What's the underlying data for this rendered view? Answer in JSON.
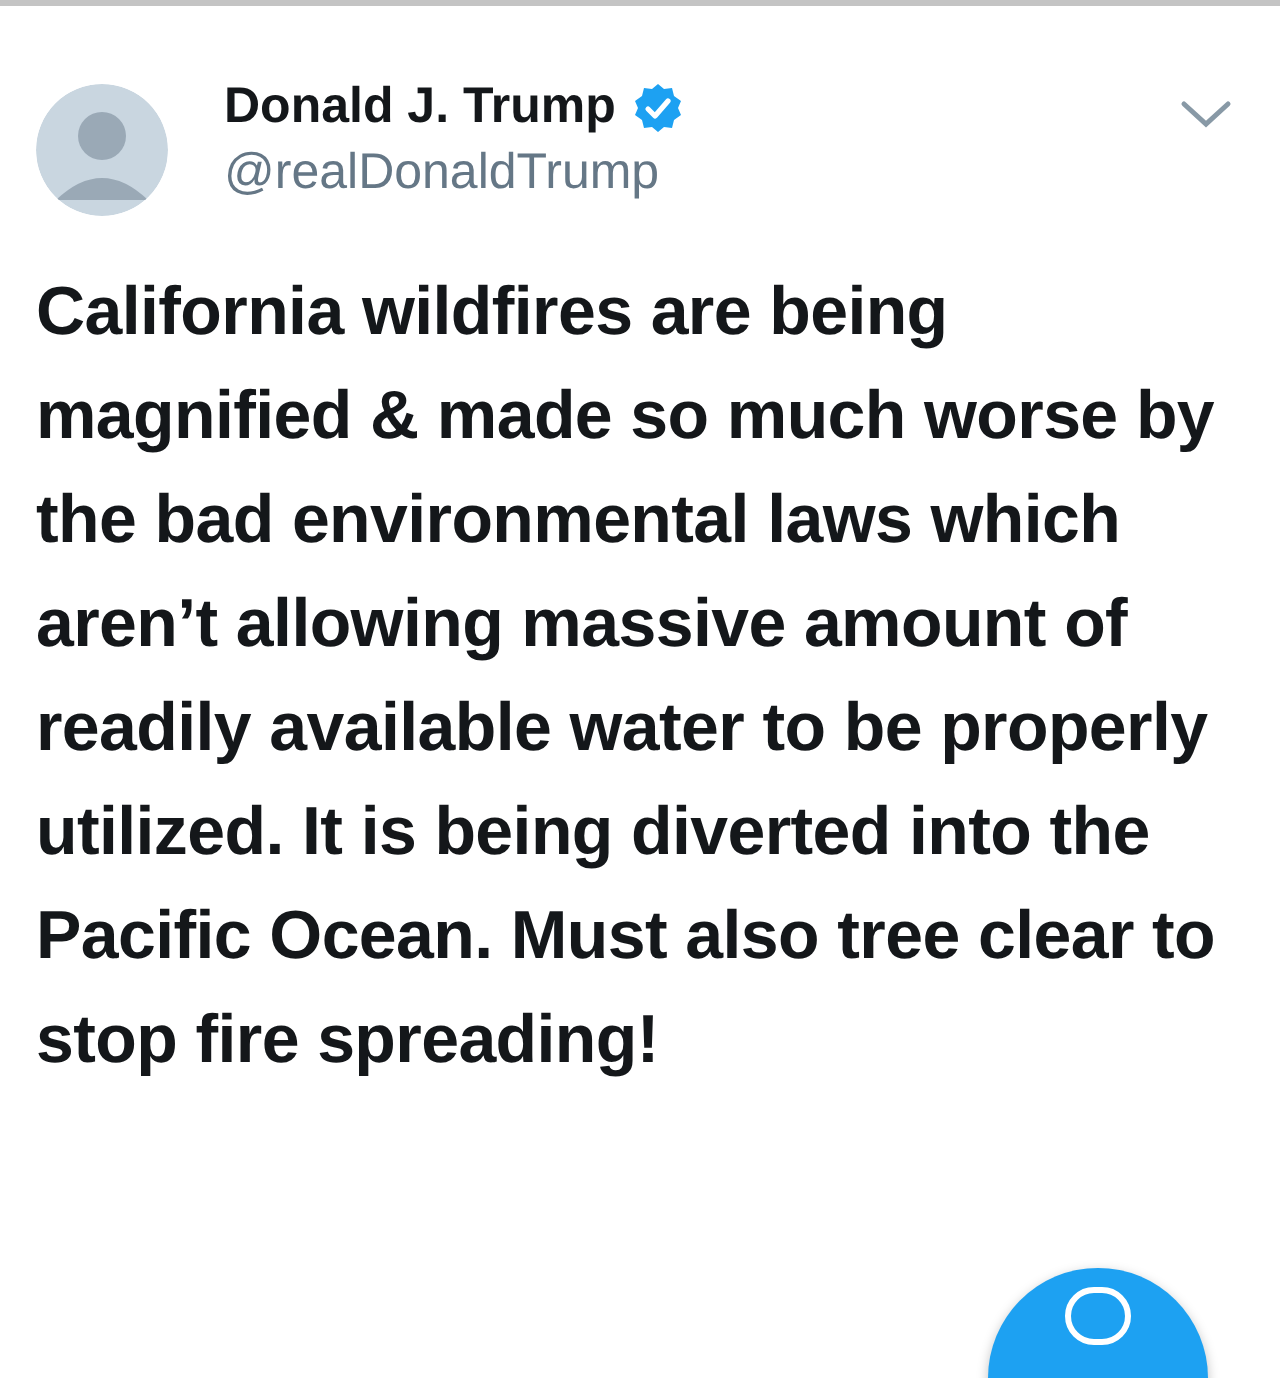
{
  "author": {
    "name": "Donald J. Trump",
    "verified": true,
    "handle": "@realDonaldTrump"
  },
  "tweet": {
    "text": "California wildfires are being magnified & made so much worse by the bad environmental laws which aren’t allowing massive amount of readily available water to be properly utilized. It is being diverted into the Pacific Ocean. Must also tree clear to stop fire spreading!"
  }
}
